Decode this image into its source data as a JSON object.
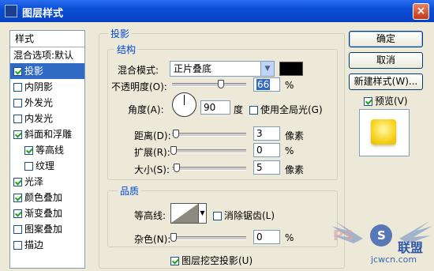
{
  "window": {
    "title": "图层样式",
    "close_label": "×"
  },
  "stylelist": {
    "header": "样式",
    "items": [
      {
        "label": "混合选项:默认",
        "checkbox": false,
        "checked": false,
        "selected": false,
        "indent": false
      },
      {
        "label": "投影",
        "checkbox": true,
        "checked": true,
        "selected": true,
        "indent": false
      },
      {
        "label": "内阴影",
        "checkbox": true,
        "checked": false,
        "selected": false,
        "indent": false
      },
      {
        "label": "外发光",
        "checkbox": true,
        "checked": false,
        "selected": false,
        "indent": false
      },
      {
        "label": "内发光",
        "checkbox": true,
        "checked": false,
        "selected": false,
        "indent": false
      },
      {
        "label": "斜面和浮雕",
        "checkbox": true,
        "checked": true,
        "selected": false,
        "indent": false
      },
      {
        "label": "等高线",
        "checkbox": true,
        "checked": true,
        "selected": false,
        "indent": true
      },
      {
        "label": "纹理",
        "checkbox": true,
        "checked": false,
        "selected": false,
        "indent": true
      },
      {
        "label": "光泽",
        "checkbox": true,
        "checked": true,
        "selected": false,
        "indent": false
      },
      {
        "label": "颜色叠加",
        "checkbox": true,
        "checked": true,
        "selected": false,
        "indent": false
      },
      {
        "label": "渐变叠加",
        "checkbox": true,
        "checked": true,
        "selected": false,
        "indent": false
      },
      {
        "label": "图案叠加",
        "checkbox": true,
        "checked": false,
        "selected": false,
        "indent": false
      },
      {
        "label": "描边",
        "checkbox": true,
        "checked": false,
        "selected": false,
        "indent": false
      }
    ]
  },
  "drop_shadow": {
    "section_title": "投影",
    "structure": {
      "title": "结构",
      "blend_mode_label": "混合模式:",
      "blend_mode_value": "正片叠底",
      "shadow_color": "#000000",
      "opacity_label": "不透明度(O):",
      "opacity_value": "66",
      "opacity_unit": "%",
      "opacity_level": 0.66,
      "angle_label": "角度(A):",
      "angle_value": "90",
      "angle_unit": "度",
      "global_light_label": "使用全局光(G)",
      "global_light_checked": false,
      "distance_label": "距离(D):",
      "distance_value": "3",
      "distance_unit": "像素",
      "spread_label": "扩展(R):",
      "spread_value": "0",
      "spread_unit": "%",
      "size_label": "大小(S):",
      "size_value": "5",
      "size_unit": "像素"
    },
    "quality": {
      "title": "品质",
      "contour_label": "等高线:",
      "antialias_label": "消除锯齿(L)",
      "antialias_checked": false,
      "noise_label": "杂色(N):",
      "noise_value": "0",
      "noise_unit": "%",
      "knockout_label": "图层挖空投影(U)",
      "knockout_checked": true
    }
  },
  "buttons": {
    "ok": "确定",
    "cancel": "取消",
    "new_style": "新建样式(W)...",
    "preview_label": "预览(V)",
    "preview_checked": true
  },
  "watermark": {
    "brand_text": "联盟",
    "logo_letter": "S",
    "url_text": "jcwcn.com",
    "side_text": "PS"
  }
}
